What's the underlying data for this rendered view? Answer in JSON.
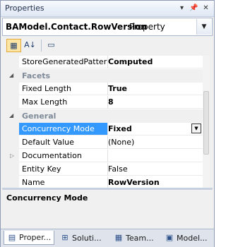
{
  "window": {
    "title": "Properties",
    "controls": [
      "▾",
      "📌",
      "✕"
    ]
  },
  "object_selector": {
    "name": "BAModel.Contact.RowVersion",
    "type": "Property"
  },
  "toolbar": {
    "categorized_icon": "▦",
    "alphabetical_icon": "A↓",
    "pages_icon": "▭"
  },
  "grid": {
    "rows": [
      {
        "kind": "prop",
        "name": "StoreGeneratedPattern",
        "value": "Computed",
        "value_bold": true
      },
      {
        "kind": "cat",
        "label": "Facets"
      },
      {
        "kind": "prop",
        "name": "Fixed Length",
        "value": "True",
        "value_bold": true
      },
      {
        "kind": "prop",
        "name": "Max Length",
        "value": "8",
        "value_bold": true
      },
      {
        "kind": "cat",
        "label": "General"
      },
      {
        "kind": "prop",
        "name": "Concurrency Mode",
        "value": "Fixed",
        "value_bold": true,
        "selected": true
      },
      {
        "kind": "prop",
        "name": "Default Value",
        "value": "(None)"
      },
      {
        "kind": "prop",
        "name": "Documentation",
        "value": "",
        "expandable": true
      },
      {
        "kind": "prop",
        "name": "Entity Key",
        "value": "False"
      },
      {
        "kind": "prop",
        "name": "Name",
        "value": "RowVersion",
        "value_bold": true
      }
    ]
  },
  "description": {
    "title": "Concurrency Mode"
  },
  "tabs": [
    {
      "label": "Proper...",
      "icon": "properties-icon",
      "glyph": "▤",
      "active": true
    },
    {
      "label": "Soluti...",
      "icon": "solution-explorer-icon",
      "glyph": "⊞"
    },
    {
      "label": "Team...",
      "icon": "team-explorer-icon",
      "glyph": "▦"
    },
    {
      "label": "Model...",
      "icon": "model-browser-icon",
      "glyph": "▣"
    }
  ]
}
